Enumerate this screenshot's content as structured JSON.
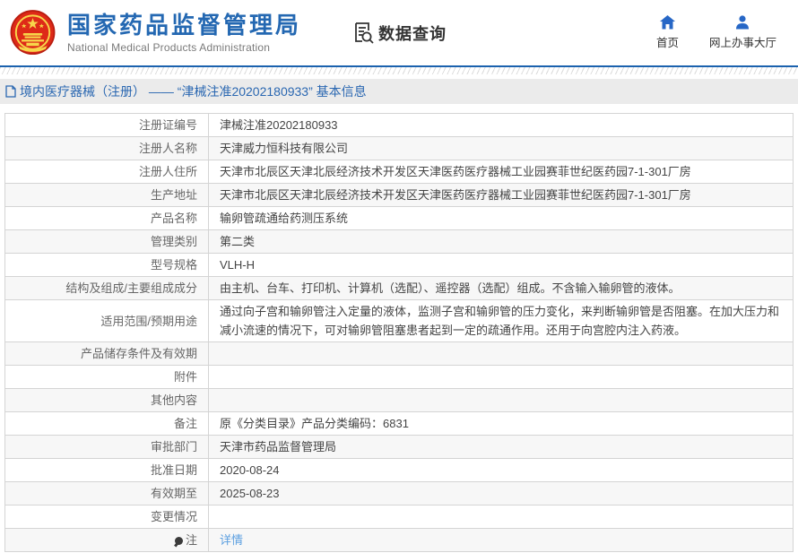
{
  "header": {
    "org_name": "国家药品监督管理局",
    "org_name_en": "National Medical Products Administration",
    "module_title": "数据查询",
    "nav": {
      "home": "首页",
      "hall": "网上办事大厅"
    }
  },
  "breadcrumb": "境内医疗器械（注册） —— “津械注准20202180933” 基本信息",
  "table": {
    "rows": [
      {
        "label": "注册证编号",
        "value": "津械注准20202180933"
      },
      {
        "label": "注册人名称",
        "value": "天津威力恒科技有限公司"
      },
      {
        "label": "注册人住所",
        "value": "天津市北辰区天津北辰经济技术开发区天津医药医疗器械工业园赛菲世纪医药园7-1-301厂房"
      },
      {
        "label": "生产地址",
        "value": "天津市北辰区天津北辰经济技术开发区天津医药医疗器械工业园赛菲世纪医药园7-1-301厂房"
      },
      {
        "label": "产品名称",
        "value": "输卵管疏通给药测压系统"
      },
      {
        "label": "管理类别",
        "value": "第二类"
      },
      {
        "label": "型号规格",
        "value": "VLH-H"
      },
      {
        "label": "结构及组成/主要组成成分",
        "value": "由主机、台车、打印机、计算机（选配）、遥控器（选配）组成。不含输入输卵管的液体。"
      },
      {
        "label": "适用范围/预期用途",
        "value": "通过向子宫和输卵管注入定量的液体，监测子宫和输卵管的压力变化，来判断输卵管是否阻塞。在加大压力和减小流速的情况下，可对输卵管阻塞患者起到一定的疏通作用。还用于向宫腔内注入药液。"
      },
      {
        "label": "产品储存条件及有效期",
        "value": ""
      },
      {
        "label": "附件",
        "value": ""
      },
      {
        "label": "其他内容",
        "value": ""
      },
      {
        "label": "备注",
        "value": "原《分类目录》产品分类编码：6831"
      },
      {
        "label": "审批部门",
        "value": "天津市药品监督管理局"
      },
      {
        "label": "批准日期",
        "value": "2020-08-24"
      },
      {
        "label": "有效期至",
        "value": "2025-08-23"
      },
      {
        "label": "变更情况",
        "value": ""
      },
      {
        "label": "注",
        "value": "详情",
        "link": true,
        "label_icon": "bulb-icon"
      }
    ]
  },
  "colors": {
    "brand_blue": "#2468b2",
    "nav_icon_blue": "#2767c6",
    "link_blue": "#5b9fe0",
    "emblem_red": "#de2a18",
    "emblem_gold": "#f7d64a",
    "band_gray": "#ebebeb",
    "row_alt_gray": "#f7f7f7"
  }
}
